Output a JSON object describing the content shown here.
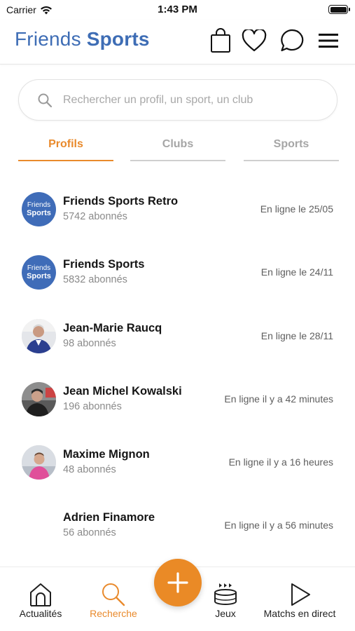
{
  "status_bar": {
    "carrier": "Carrier",
    "time": "1:43 PM"
  },
  "header": {
    "brand_light": "Friends",
    "brand_bold": "Sports",
    "icons": [
      "shopping-bag-icon",
      "heart-icon",
      "chat-bubble-icon",
      "menu-icon"
    ]
  },
  "search": {
    "placeholder": "Rechercher un profil, un sport, un club",
    "value": ""
  },
  "tabs": [
    {
      "label": "Profils",
      "active": true
    },
    {
      "label": "Clubs",
      "active": false
    },
    {
      "label": "Sports",
      "active": false
    }
  ],
  "profiles": [
    {
      "name": "Friends Sports Retro",
      "followers": "5742 abonnés",
      "status": "En ligne le 25/05",
      "avatar": "logo",
      "avatar_text": [
        "Friends",
        "Sports"
      ]
    },
    {
      "name": "Friends Sports",
      "followers": "5832 abonnés",
      "status": "En ligne le 24/11",
      "avatar": "logo",
      "avatar_text": [
        "Friends",
        "Sports"
      ]
    },
    {
      "name": "Jean-Marie Raucq",
      "followers": "98 abonnés",
      "status": "En ligne le 28/11",
      "avatar": "photo"
    },
    {
      "name": "Jean Michel Kowalski",
      "followers": "196 abonnés",
      "status": "En ligne il y a 42 minutes",
      "avatar": "photo"
    },
    {
      "name": "Maxime Mignon",
      "followers": "48 abonnés",
      "status": "En ligne il y a 16 heures",
      "avatar": "photo"
    },
    {
      "name": "Adrien Finamore",
      "followers": "56 abonnés",
      "status": "En ligne il y a 56 minutes",
      "avatar": "none"
    }
  ],
  "bottom_nav": [
    {
      "label": "Actualités",
      "icon": "home-icon",
      "active": false
    },
    {
      "label": "Recherche",
      "icon": "search-icon",
      "active": true
    },
    {
      "label": "Jeux",
      "icon": "games-icon",
      "active": false
    },
    {
      "label": "Matchs en direct",
      "icon": "play-icon",
      "active": false
    }
  ],
  "fab": {
    "icon": "plus-icon"
  },
  "colors": {
    "brand_blue": "#3e6db5",
    "accent_orange": "#e98a2c",
    "avatar_blue": "#3f6cb8"
  }
}
